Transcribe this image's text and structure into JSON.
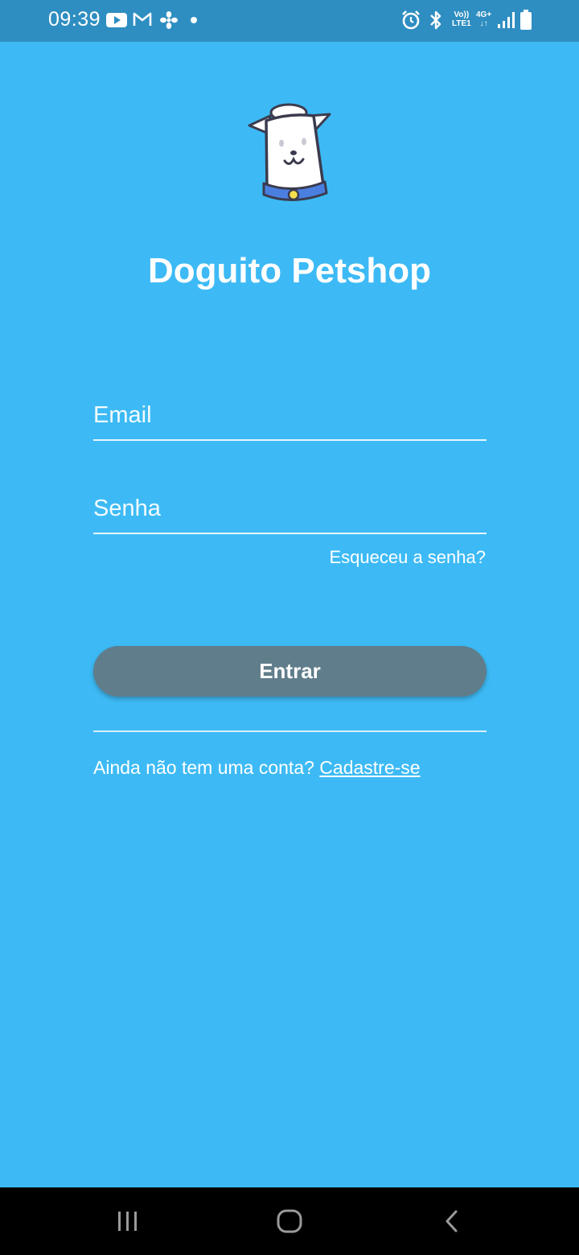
{
  "status_bar": {
    "time": "09:39",
    "volte_line1": "Vo))",
    "volte_line2": "LTE1",
    "network_line1": "4G+",
    "network_line2": "↓↑",
    "icons": [
      "youtube-icon",
      "gmail-icon",
      "fan-icon",
      "dot-icon",
      "alarm-icon",
      "bluetooth-icon",
      "signal-icon",
      "battery-icon"
    ]
  },
  "app": {
    "title": "Doguito Petshop",
    "logo": "dog-logo"
  },
  "form": {
    "email_placeholder": "Email",
    "email_value": "",
    "password_placeholder": "Senha",
    "password_value": "",
    "forgot_label": "Esqueceu a senha?",
    "login_label": "Entrar",
    "signup_prompt": "Ainda não tem uma conta?",
    "signup_link": "Cadastre-se"
  },
  "nav_bar": {
    "buttons": [
      "recents",
      "home",
      "back"
    ]
  },
  "colors": {
    "background": "#3dbaf5",
    "status_bar": "#2f8ec1",
    "button": "#607d8b",
    "text": "#ffffff"
  }
}
